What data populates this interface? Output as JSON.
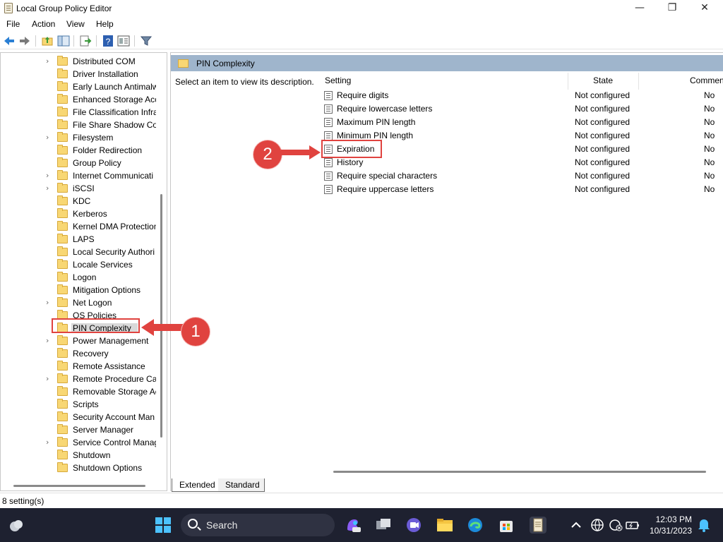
{
  "window": {
    "title": "Local Group Policy Editor",
    "minimize": "—",
    "maximize": "❐",
    "close": "✕"
  },
  "menu": [
    "File",
    "Action",
    "View",
    "Help"
  ],
  "tree": [
    {
      "label": "Distributed COM",
      "expandable": true
    },
    {
      "label": "Driver Installation",
      "expandable": false
    },
    {
      "label": "Early Launch Antimalw",
      "expandable": false
    },
    {
      "label": "Enhanced Storage Acc",
      "expandable": false
    },
    {
      "label": "File Classification Infra",
      "expandable": false
    },
    {
      "label": "File Share Shadow Cop",
      "expandable": false
    },
    {
      "label": "Filesystem",
      "expandable": true
    },
    {
      "label": "Folder Redirection",
      "expandable": false
    },
    {
      "label": "Group Policy",
      "expandable": false
    },
    {
      "label": "Internet Communicati",
      "expandable": true
    },
    {
      "label": "iSCSI",
      "expandable": true
    },
    {
      "label": "KDC",
      "expandable": false
    },
    {
      "label": "Kerberos",
      "expandable": false
    },
    {
      "label": "Kernel DMA Protection",
      "expandable": false
    },
    {
      "label": "LAPS",
      "expandable": false
    },
    {
      "label": "Local Security Authori",
      "expandable": false
    },
    {
      "label": "Locale Services",
      "expandable": false
    },
    {
      "label": "Logon",
      "expandable": false
    },
    {
      "label": "Mitigation Options",
      "expandable": false
    },
    {
      "label": "Net Logon",
      "expandable": true
    },
    {
      "label": "OS Policies",
      "expandable": false
    },
    {
      "label": "PIN Complexity",
      "expandable": false,
      "selected": true
    },
    {
      "label": "Power Management",
      "expandable": true
    },
    {
      "label": "Recovery",
      "expandable": false
    },
    {
      "label": "Remote Assistance",
      "expandable": false
    },
    {
      "label": "Remote Procedure Ca",
      "expandable": true
    },
    {
      "label": "Removable Storage Ac",
      "expandable": false
    },
    {
      "label": "Scripts",
      "expandable": false
    },
    {
      "label": "Security Account Man",
      "expandable": false
    },
    {
      "label": "Server Manager",
      "expandable": false
    },
    {
      "label": "Service Control Manag",
      "expandable": true
    },
    {
      "label": "Shutdown",
      "expandable": false
    },
    {
      "label": "Shutdown Options",
      "expandable": false
    }
  ],
  "pane": {
    "title": "PIN Complexity",
    "description": "Select an item to view its description.",
    "columns": {
      "setting": "Setting",
      "state": "State",
      "comment": "Commen"
    }
  },
  "settings": [
    {
      "name": "Require digits",
      "state": "Not configured",
      "comment": "No"
    },
    {
      "name": "Require lowercase letters",
      "state": "Not configured",
      "comment": "No"
    },
    {
      "name": "Maximum PIN length",
      "state": "Not configured",
      "comment": "No"
    },
    {
      "name": "Minimum PIN length",
      "state": "Not configured",
      "comment": "No"
    },
    {
      "name": "Expiration",
      "state": "Not configured",
      "comment": "No"
    },
    {
      "name": "History",
      "state": "Not configured",
      "comment": "No"
    },
    {
      "name": "Require special characters",
      "state": "Not configured",
      "comment": "No"
    },
    {
      "name": "Require uppercase letters",
      "state": "Not configured",
      "comment": "No"
    }
  ],
  "tabs": {
    "extended": "Extended",
    "standard": "Standard"
  },
  "status": "8 setting(s)",
  "taskbar": {
    "search": "Search",
    "time": "12:03 PM",
    "date": "10/31/2023"
  },
  "annotations": {
    "step1": "1",
    "step2": "2",
    "color": "#e0433f"
  }
}
